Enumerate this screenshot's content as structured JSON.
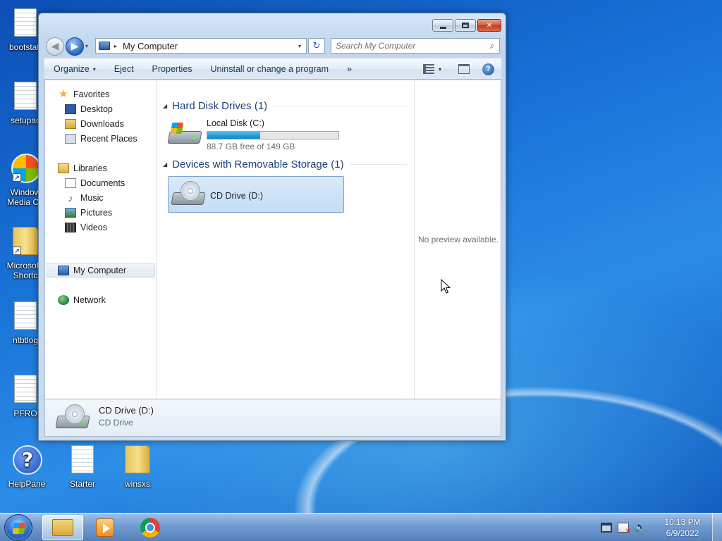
{
  "desktop": {
    "icons": [
      {
        "label": "bootstat."
      },
      {
        "label": "setupac"
      },
      {
        "label": "Window Media Ce"
      },
      {
        "label": "Microsof - Shortc"
      },
      {
        "label": "ntbtlog"
      },
      {
        "label": "PFRO"
      },
      {
        "label": "HelpPane"
      },
      {
        "label": "Starter"
      },
      {
        "label": "winsxs"
      }
    ]
  },
  "window": {
    "title_buttons": {
      "minimize": "minimize",
      "maximize": "maximize",
      "close": "✕"
    },
    "nav": {
      "back": "◀",
      "forward": "▶",
      "history": "▾"
    },
    "address": {
      "separator": "▸",
      "path": "My Computer",
      "dropdown": "▾"
    },
    "refresh": "↻",
    "search": {
      "placeholder": "Search My Computer",
      "icon": "⌕"
    },
    "commands": {
      "organize": "Organize",
      "organize_arrow": "▾",
      "eject": "Eject",
      "properties": "Properties",
      "uninstall": "Uninstall or change a program",
      "more": "»",
      "views_arrow": "▾",
      "help": "?"
    },
    "navpane": {
      "favorites": "Favorites",
      "desktop": "Desktop",
      "downloads": "Downloads",
      "recent": "Recent Places",
      "libraries": "Libraries",
      "documents": "Documents",
      "music": "Music",
      "pictures": "Pictures",
      "videos": "Videos",
      "computer": "My Computer",
      "network": "Network",
      "star_glyph": "★",
      "note_glyph": "♪"
    },
    "groups": {
      "hdd": {
        "tri": "◢",
        "title": "Hard Disk Drives (1)"
      },
      "removable": {
        "tri": "◢",
        "title": "Devices with Removable Storage (1)"
      }
    },
    "drives": {
      "c": {
        "name": "Local Disk (C:)",
        "free": "88.7 GB free of 149 GB",
        "used_fraction": 0.405
      },
      "d": {
        "name": "CD Drive (D:)"
      }
    },
    "preview": {
      "text": "No preview available."
    },
    "details": {
      "name": "CD Drive (D:)",
      "type": "CD Drive"
    }
  },
  "taskbar": {
    "clock": {
      "time": "10:13 PM",
      "date": "6/9/2022"
    },
    "volume_glyph": "🔈"
  },
  "colors": {
    "accent": "#1e3f7a",
    "selection": "#c4dcf5",
    "capacity_fill": "#23a0d6"
  }
}
